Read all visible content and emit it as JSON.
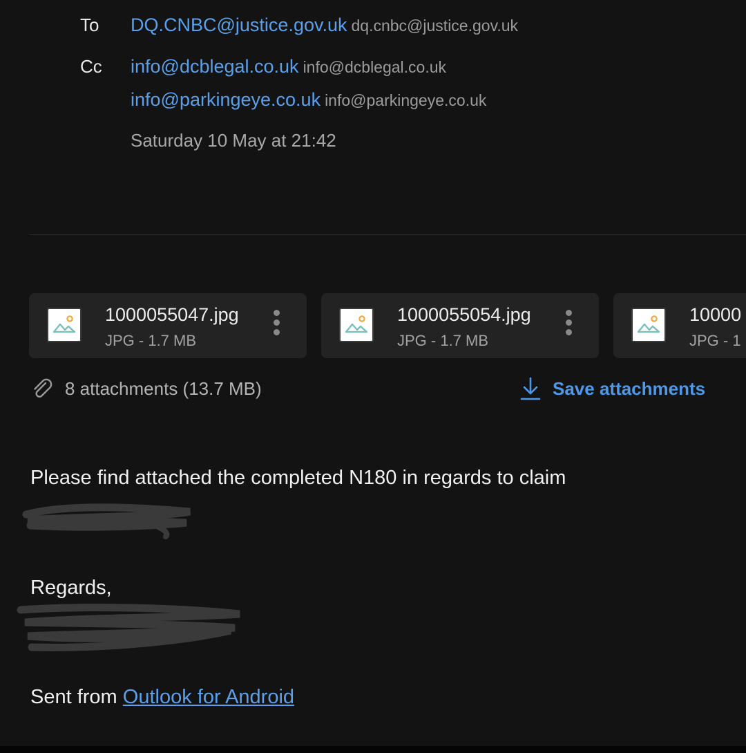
{
  "header": {
    "to_label": "To",
    "cc_label": "Cc",
    "to": [
      {
        "name": "DQ.CNBC@justice.gov.uk",
        "address": "dq.cnbc@justice.gov.uk"
      }
    ],
    "cc": [
      {
        "name": "info@dcblegal.co.uk",
        "address": "info@dcblegal.co.uk"
      },
      {
        "name": "info@parkingeye.co.uk",
        "address": "info@parkingeye.co.uk"
      }
    ],
    "date": "Saturday 10 May at 21:42"
  },
  "attachments": {
    "items": [
      {
        "name": "1000055047.jpg",
        "meta": "JPG - 1.7 MB"
      },
      {
        "name": "1000055054.jpg",
        "meta": "JPG - 1.7 MB"
      },
      {
        "name": "10000",
        "meta": "JPG - 1"
      }
    ],
    "summary": "8 attachments (13.7 MB)",
    "save_label": "Save attachments"
  },
  "body": {
    "line1": "Please find attached the completed N180 in regards to claim",
    "regards": "Regards,",
    "sent_from_prefix": "Sent from ",
    "sent_from_link": "Outlook for Android"
  },
  "colors": {
    "background": "#131313",
    "link": "#5aa0ea",
    "accent": "#4d99e8",
    "card": "#232323"
  },
  "icons": {
    "thumbnail": "image-icon",
    "menu": "more-vertical-icon",
    "paperclip": "paperclip-icon",
    "download": "download-icon"
  }
}
